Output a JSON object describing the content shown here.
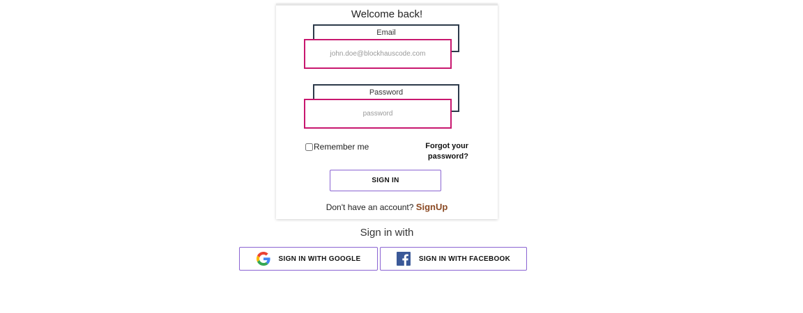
{
  "login_card": {
    "title": "Welcome back!",
    "email": {
      "label": "Email",
      "placeholder": "john.doe@blockhauscode.com",
      "value": ""
    },
    "password": {
      "label": "Password",
      "placeholder": "password",
      "value": ""
    },
    "remember_label": "Remember me",
    "remember_checked": false,
    "forgot_line1": "Forgot your",
    "forgot_line2": "password?",
    "signin_label": "SIGN IN",
    "no_account_text": "Don't have an account?",
    "signup_label": "SignUp"
  },
  "social": {
    "heading": "Sign in with",
    "google_label": "SIGN IN WITH GOOGLE",
    "facebook_label": "SIGN IN WITH FACEBOOK",
    "google_icon": "google-icon",
    "facebook_icon": "facebook-icon"
  },
  "colors": {
    "input_border": "#c8176f",
    "input_shadow_border": "#2c3a4a",
    "button_border": "#8a63d2",
    "signup_link": "#8b4a24",
    "facebook_blue": "#3b5998"
  }
}
